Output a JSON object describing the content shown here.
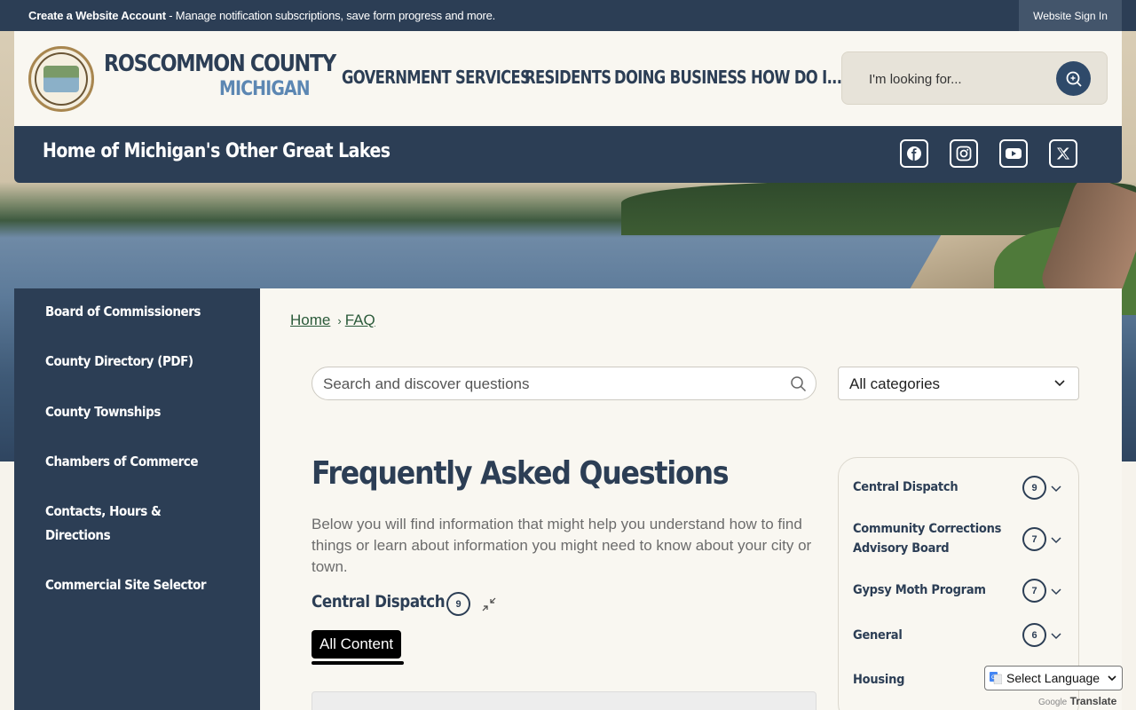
{
  "topbar": {
    "create_account": "Create a Website Account",
    "message": " - Manage notification subscriptions, save form progress and more.",
    "sign_in": "Website Sign In"
  },
  "header": {
    "county_name": "ROSCOMMON COUNTY",
    "state": "MICHIGAN",
    "nav": [
      "GOVERNMENT",
      "SERVICES",
      "RESIDENTS",
      "DOING BUSINESS",
      "HOW DO I..."
    ],
    "search_placeholder": "I'm looking for..."
  },
  "tagline": "Home of Michigan's Other Great Lakes",
  "social": [
    "facebook-icon",
    "instagram-icon",
    "youtube-icon",
    "x-twitter-icon"
  ],
  "sidebar": {
    "items": [
      {
        "label": "Board of Commissioners"
      },
      {
        "label": "County Directory (PDF)"
      },
      {
        "label": "County Townships"
      },
      {
        "label": "Chambers of Commerce"
      },
      {
        "label": "Contacts, Hours &"
      },
      {
        "label": "Directions"
      },
      {
        "label": "Commercial Site Selector"
      }
    ]
  },
  "breadcrumb": {
    "home": "Home",
    "sep": "›",
    "current": "FAQ"
  },
  "faq": {
    "search_placeholder": "Search and discover questions",
    "category_selected": "All categories",
    "title": "Frequently Asked Questions",
    "intro": "Below you will find information that might help you understand how to find things or learn about information you might need to know about your city or town.",
    "section_title": "Central Dispatch",
    "section_count": "9",
    "tab_label": "All Content"
  },
  "categories": [
    {
      "name": "Central Dispatch",
      "count": "9"
    },
    {
      "name": "Community Corrections",
      "name2": "Advisory Board",
      "count": "7"
    },
    {
      "name": "Gypsy Moth Program",
      "count": "7"
    },
    {
      "name": "General",
      "count": "6"
    },
    {
      "name": "Housing",
      "count": ""
    }
  ],
  "translate": {
    "select_label": "Select Language",
    "powered_brand": "Google",
    "powered_text": "Translate"
  },
  "colors": {
    "navy": "#2c3e55",
    "cream": "#f9f7f1",
    "link_green": "#2b5a3a"
  }
}
